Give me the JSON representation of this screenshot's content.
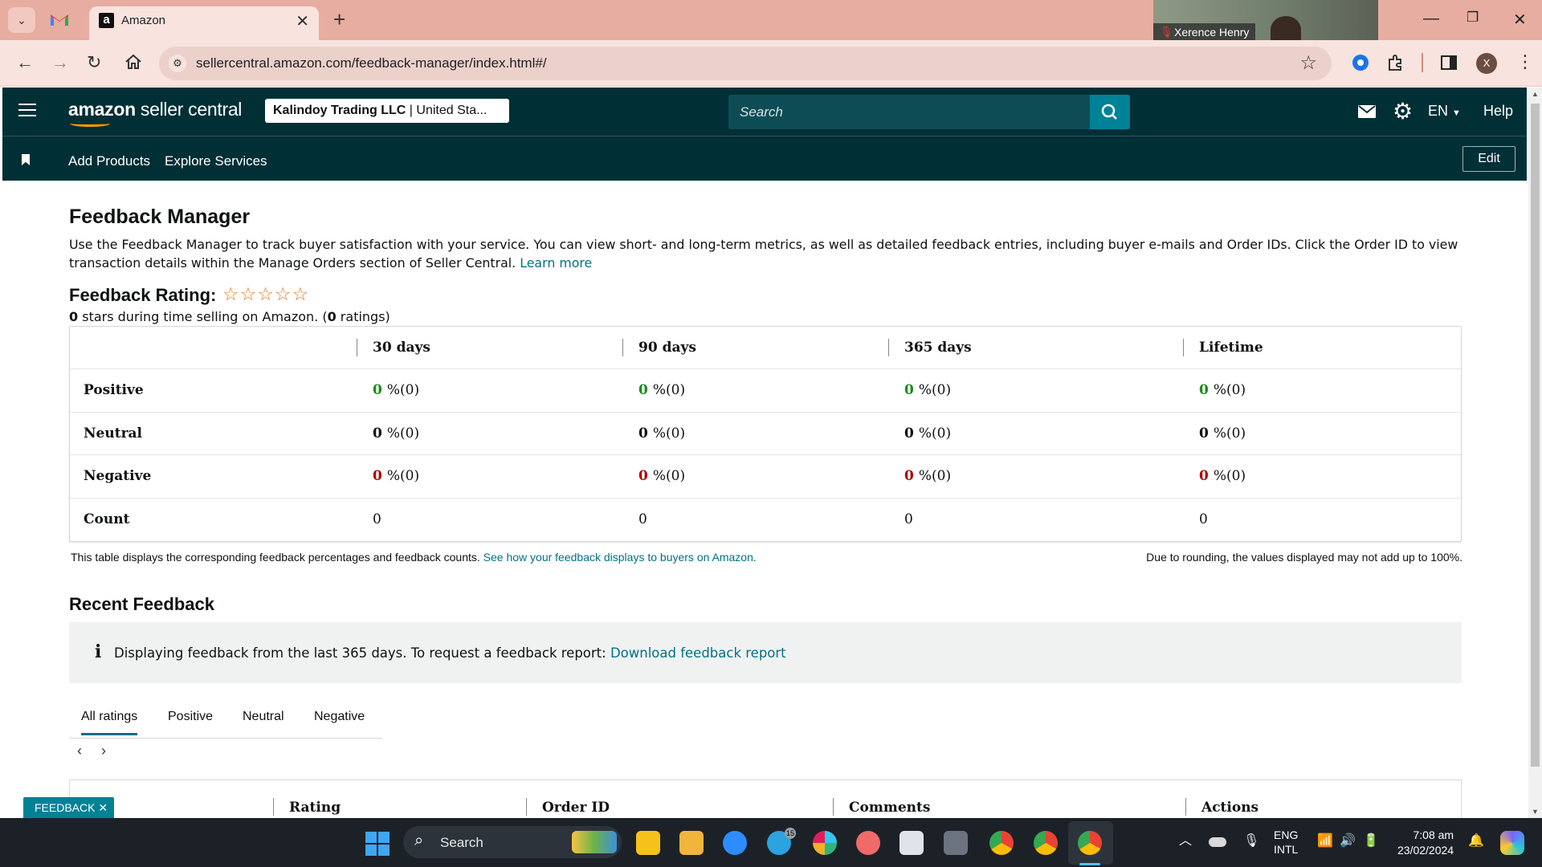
{
  "browser": {
    "tab_title": "Amazon",
    "url": "sellercentral.amazon.com/feedback-manager/index.html#/",
    "zoom_participant": "Xerence Henry",
    "profile_initial": "X"
  },
  "header": {
    "logo_bold": "amazon",
    "logo_rest": " seller central",
    "store_name": "Kalindoy Trading LLC",
    "store_region": " | United Sta...",
    "search_placeholder": "Search",
    "language": "EN",
    "help": "Help"
  },
  "subnav": {
    "links": [
      "Add Products",
      "Explore Services"
    ],
    "edit": "Edit"
  },
  "page": {
    "title": "Feedback Manager",
    "intro": "Use the Feedback Manager to track buyer satisfaction with your service. You can view short- and long-term metrics, as well as detailed feedback entries, including buyer e-mails and Order IDs. Click the Order ID to view transaction details within the Manage Orders section of Seller Central. ",
    "learn_more": "Learn more",
    "rating_label": "Feedback Rating:",
    "stars": "☆☆☆☆☆",
    "rating_stars_value": "0",
    "rating_sub_middle": " stars during time selling on Amazon. (",
    "rating_count": "0",
    "rating_sub_end": " ratings)"
  },
  "table": {
    "columns": [
      "30 days",
      "90 days",
      "365 days",
      "Lifetime"
    ],
    "rows": [
      {
        "label": "Positive",
        "values": [
          "0",
          "0",
          "0",
          "0"
        ],
        "suffix": [
          "%(0)",
          "%(0)",
          "%(0)",
          "%(0)"
        ]
      },
      {
        "label": "Neutral",
        "values": [
          "0",
          "0",
          "0",
          "0"
        ],
        "suffix": [
          "%(0)",
          "%(0)",
          "%(0)",
          "%(0)"
        ]
      },
      {
        "label": "Negative",
        "values": [
          "0",
          "0",
          "0",
          "0"
        ],
        "suffix": [
          "%(0)",
          "%(0)",
          "%(0)",
          "%(0)"
        ]
      },
      {
        "label": "Count",
        "values": [
          "0",
          "0",
          "0",
          "0"
        ]
      }
    ],
    "note": "This table displays the corresponding feedback percentages and feedback counts. ",
    "note_link": "See how your feedback displays to buyers on Amazon.",
    "rounding_note": "Due to rounding, the values displayed may not add up to 100%."
  },
  "recent": {
    "title": "Recent Feedback",
    "info_text": "Displaying feedback from the last 365 days. To request a feedback report: ",
    "info_link": "Download feedback report",
    "tabs": [
      "All ratings",
      "Positive",
      "Neutral",
      "Negative"
    ],
    "list_columns": [
      "Rating",
      "Order ID",
      "Comments",
      "Actions"
    ],
    "feedback_button": "FEEDBACK ✕"
  },
  "taskbar": {
    "search": "Search",
    "lang_top": "ENG",
    "lang_bottom": "INTL",
    "time": "7:08 am",
    "date": "23/02/2024",
    "telegram_badge": "15"
  },
  "colors": {
    "header_bg": "#002f36",
    "link": "#007185",
    "positive": "#1a8b1a",
    "negative": "#b00000",
    "tabbar": "#e7ada1"
  }
}
